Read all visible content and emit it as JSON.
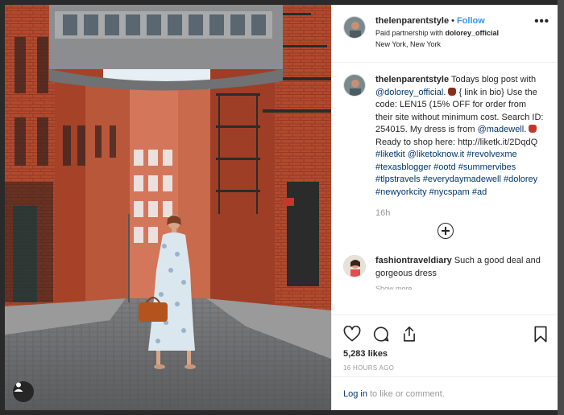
{
  "post": {
    "username": "thelenparentstyle",
    "separator": "•",
    "follow_label": "Follow",
    "paid_prefix": "Paid partnership with ",
    "partner": "dolorey_official",
    "location": "New York, New York",
    "more_label": "•••"
  },
  "caption": {
    "username": "thelenparentstyle",
    "part1": "Todays blog post with ",
    "mention1": "@dolorey_official",
    "part2": ". ",
    "part3": " { link in bio} Use the code: LEN15 (15% OFF for order from their site without minimum cost. Search ID: 254015. My dress is from ",
    "mention2": "@madewell",
    "part4": ". ",
    "part5": " Ready to shop here: http://liketk.it/2DqdQ ",
    "tag1": "#liketkit",
    "mention3": "@liketoknow.it",
    "tag2": "#revolvexme",
    "tag3": "#texasblogger",
    "tag4": "#ootd",
    "tag5": "#summervibes",
    "tag6": "#tlpstravels",
    "tag7": "#everydaymadewell",
    "tag8": "#dolorey",
    "tag9": "#newyorkcity",
    "tag10": "#nycspam",
    "tag11": "#ad",
    "time": "16h"
  },
  "comments": [
    {
      "username": "fashiontraveldiary",
      "text": "Such a good deal and gorgeous dress"
    }
  ],
  "cut_off_text": "Show more",
  "actions": {
    "likes": "5,283 likes",
    "date": "16 HOURS AGO",
    "login_link": "Log in",
    "login_text": "to like or comment."
  },
  "icons": {
    "like": "heart-icon",
    "comment": "comment-bubble-icon",
    "share": "share-icon",
    "save": "bookmark-icon",
    "more": "more-options-icon",
    "load_more": "plus-circle-icon",
    "user_tag": "user-tag-icon"
  },
  "colors": {
    "link": "#003569",
    "follow": "#3897f0",
    "muted": "#999999",
    "text": "#262626"
  }
}
